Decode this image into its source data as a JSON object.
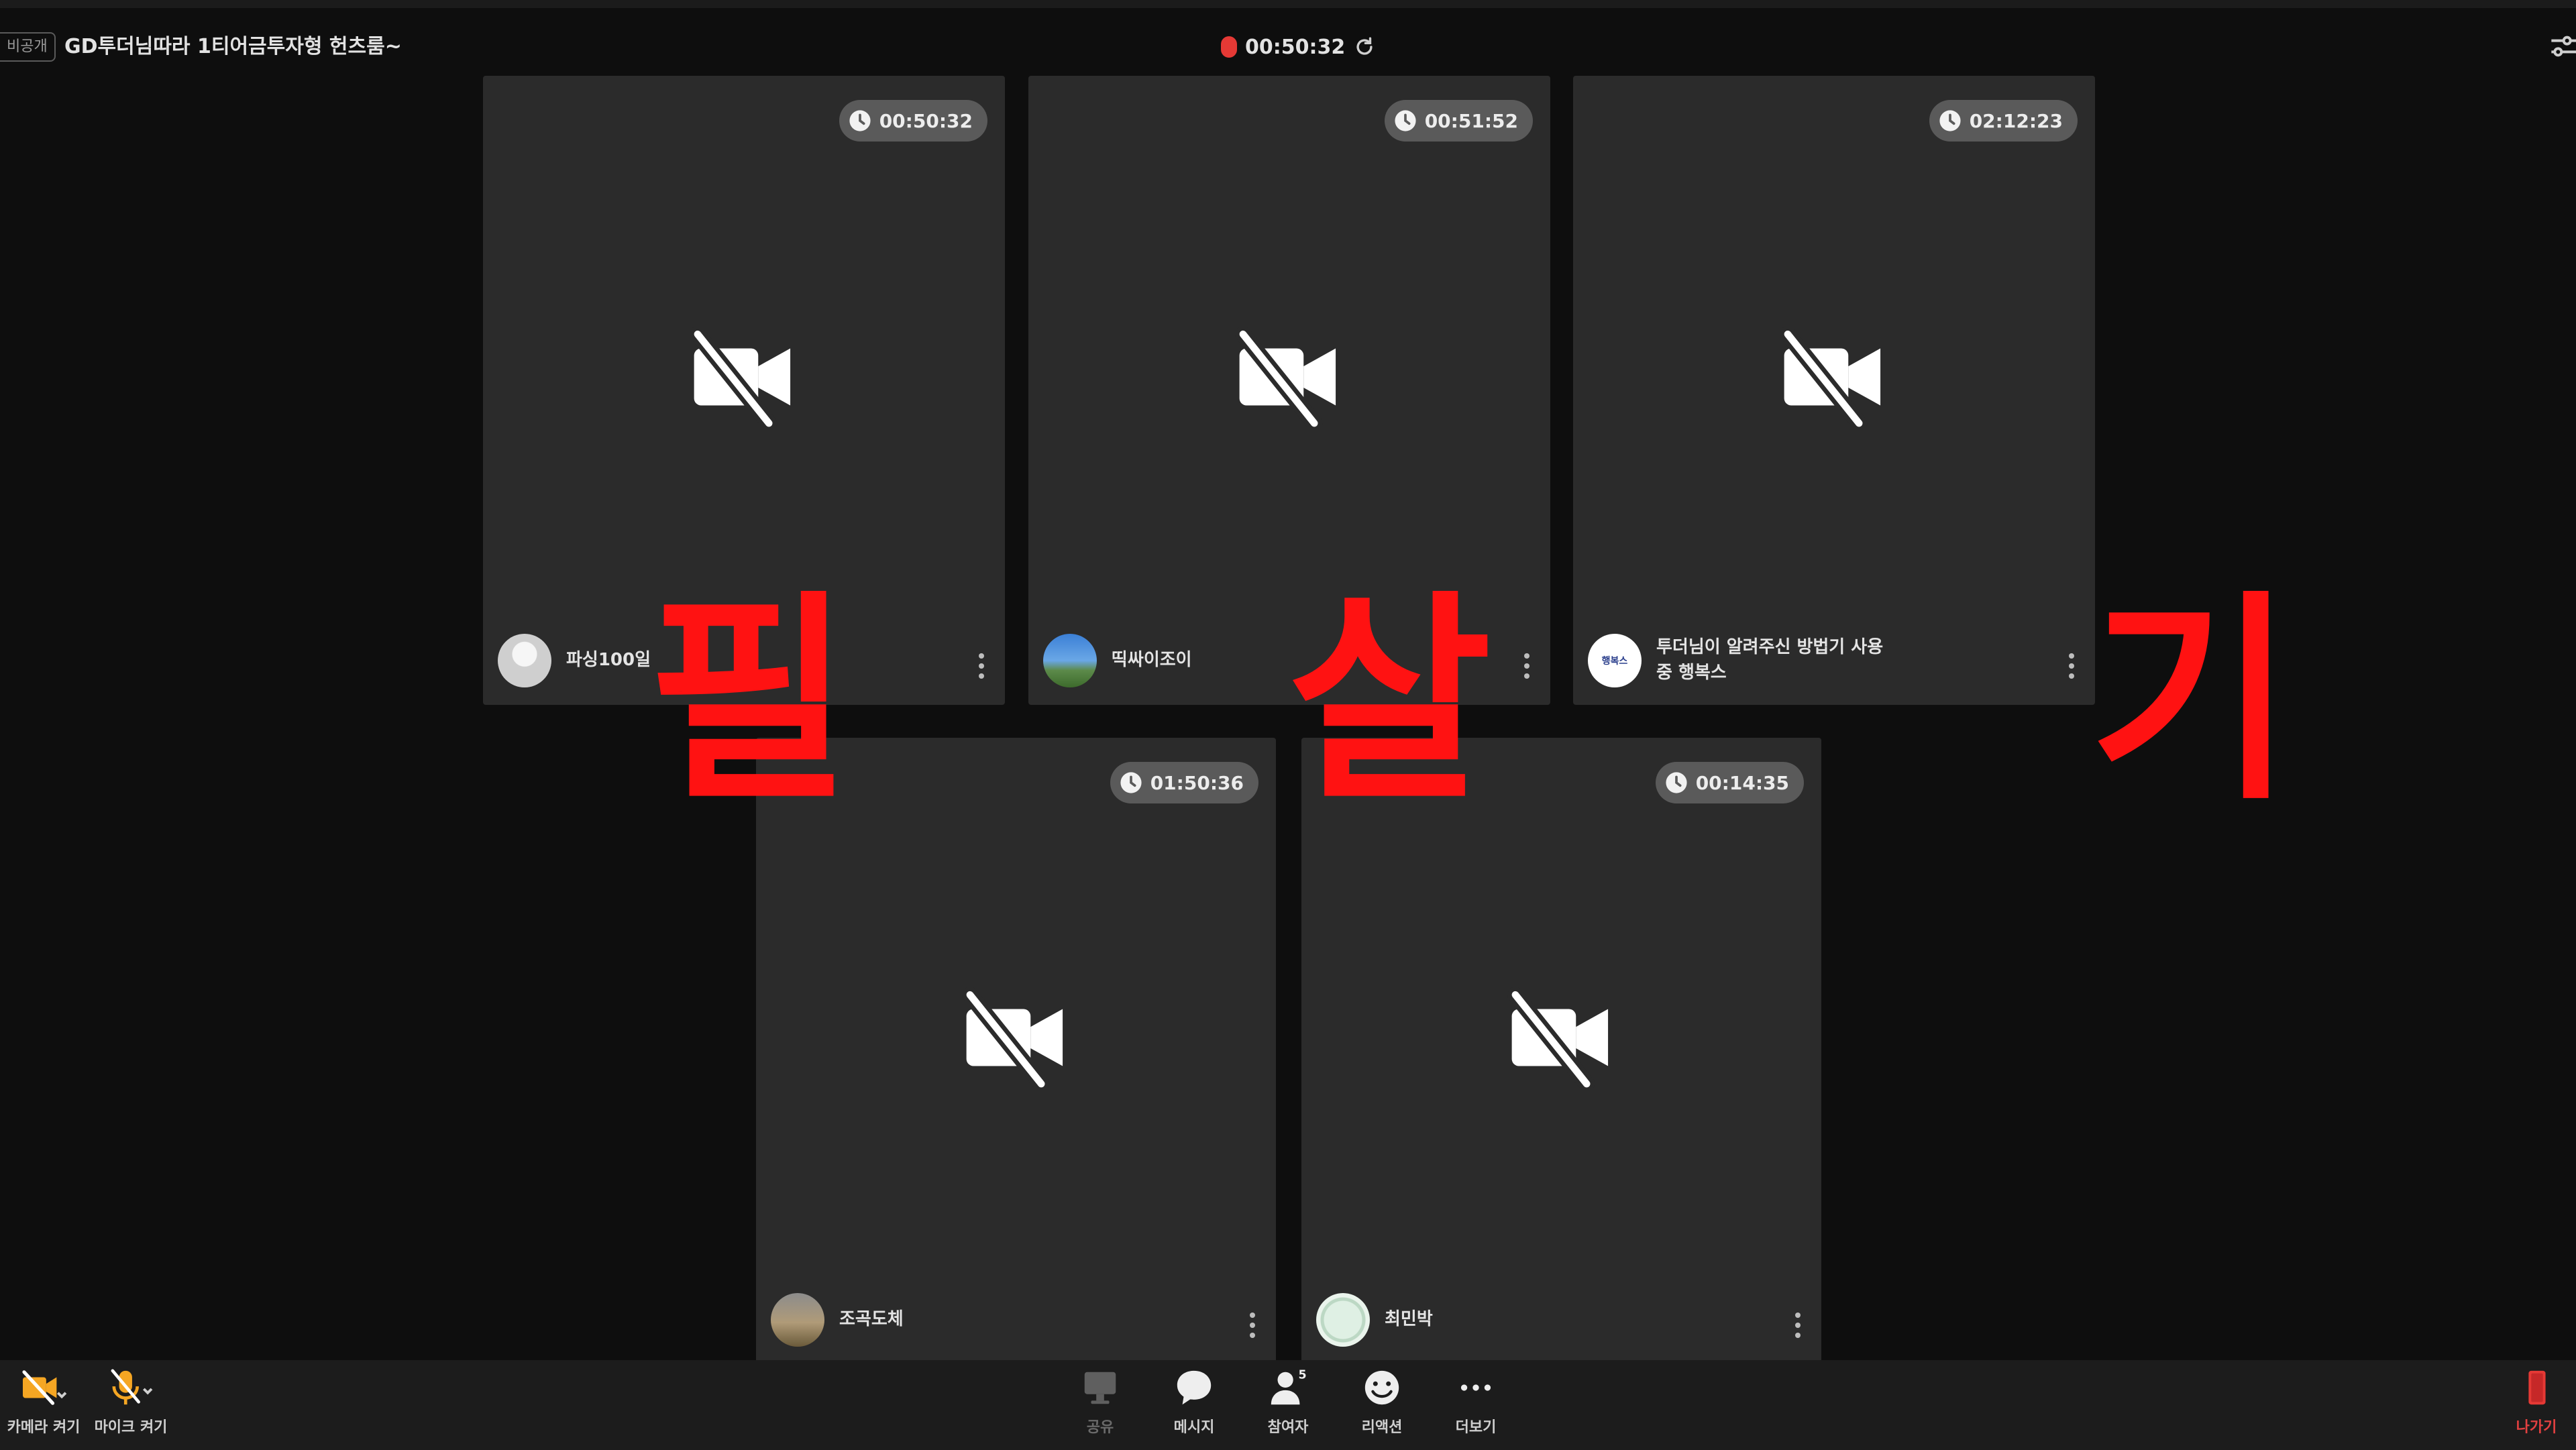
{
  "header": {
    "visibility_badge": "비공개",
    "room_title": "GD투더님따라 1티어금투자형 헌츠룸~",
    "recording_time": "00:50:32",
    "icons": {
      "recording": "record-dot-icon",
      "sync": "refresh-icon",
      "settings": "sliders-icon"
    }
  },
  "tiles": [
    {
      "timer": "00:50:32",
      "name": "파싱100일",
      "avatar": "grey-person"
    },
    {
      "timer": "00:51:52",
      "name": "띡싸이조이",
      "avatar": "sky-landscape"
    },
    {
      "timer": "02:12:23",
      "name": "투더님이 알려주신 방법기 사용중 행복스",
      "avatar": "logo",
      "avatar_text": "행복스"
    },
    {
      "timer": "01:50:36",
      "name": "조곡도체",
      "avatar": "dusk-photo"
    },
    {
      "timer": "00:14:35",
      "name": "최민박",
      "avatar": "seal"
    }
  ],
  "overlay_text": [
    "필",
    "살",
    "기"
  ],
  "toolbar": {
    "camera": "카메라 켜기",
    "mic": "마이크 켜기",
    "share": "공유",
    "chat": "메시지",
    "participants": "참여자",
    "participants_count": "5",
    "reaction": "리액션",
    "more": "더보기",
    "leave": "나가기"
  },
  "colors": {
    "background": "#0e0e0e",
    "tile": "#2b2b2b",
    "toolbar": "#1c1c1c",
    "overlay": "#ff1212",
    "recording": "#e53935",
    "camera_accent": "#f5a623"
  }
}
